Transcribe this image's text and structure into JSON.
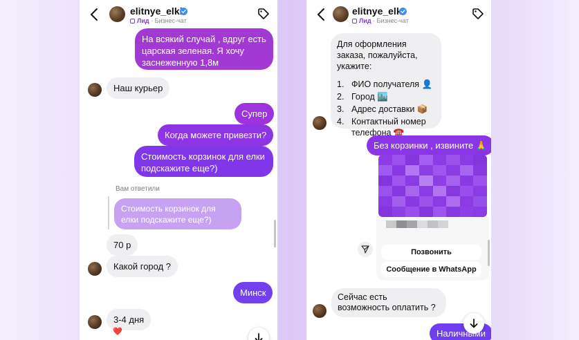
{
  "colors": {
    "accent_purple": "#9b3ad8",
    "accent_violet": "#6f3ef0",
    "incoming_bubble": "#efeff1",
    "quote_bubble": "#c8a2f2",
    "verified_badge": "#3a8ef6"
  },
  "left_chat": {
    "header": {
      "username": "elitnye_elki",
      "lead_label": "Лид",
      "subtitle": "Бизнес-чат"
    },
    "messages": {
      "m1": "На всякий случай , вдруг есть царская зеленая. Я хочу заснеженную 1,8м",
      "m2": "Наш курьер",
      "m3": "Супер",
      "m4": "Когда можете привезти?",
      "m5": "Стоимость корзинок для елки подскажите еще?)",
      "replied_label": "Вам ответили",
      "quote": "Стоимость корзинок для елки подскажите еще?)",
      "m6": "70 р",
      "m7": "Какой город ?",
      "m8": "Минск",
      "m9": "3-4 дня",
      "reaction": "❤️"
    }
  },
  "right_chat": {
    "header": {
      "username": "elitnye_elki",
      "lead_label": "Лид",
      "subtitle": "Бизнес-чат"
    },
    "order_intro": "Для оформления заказа, пожалуйста, укажите:",
    "order_items": [
      {
        "num": "1.",
        "text": "ФИО получателя 👤"
      },
      {
        "num": "2.",
        "text": "Город 🏙️"
      },
      {
        "num": "3.",
        "text": "Адрес доставки 📦"
      },
      {
        "num": "4.",
        "text": "Контактный номер телефона ☎️"
      }
    ],
    "m_no_baskets": "Без корзинки , извините 🙏",
    "card": {
      "call_button": "Позвонить",
      "whatsapp_button": "Сообщение в WhatsApp"
    },
    "m_payment_question": "Сейчас есть возможность оплатить ?",
    "m_cash": "Наличными"
  }
}
